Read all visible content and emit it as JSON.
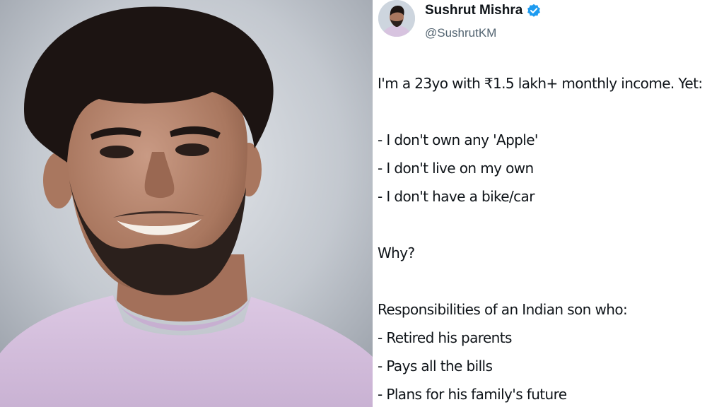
{
  "photo": {
    "subject": "smiling man"
  },
  "tweet": {
    "author": {
      "display_name": "Sushrut Mishra",
      "handle": "@SushrutKM",
      "verified": true
    },
    "lines": {
      "intro": "I'm a 23yo with ₹1.5 lakh+ monthly income. Yet:",
      "no_apple": "- I don't own any 'Apple'",
      "no_live_alone": "- I don't live on my own",
      "no_vehicle": "- I don't have a bike/car",
      "why": "Why?",
      "responsibilities": "Responsibilities of an Indian son who:",
      "retired_parents": "- Retired his parents",
      "pays_bills": "- Pays all the bills",
      "plans_future": "- Plans for his family's future"
    }
  },
  "colors": {
    "name_text": "#0f1419",
    "handle_text": "#536471",
    "verified_badge": "#1d9bf0",
    "shirt": "#d7c3df"
  }
}
